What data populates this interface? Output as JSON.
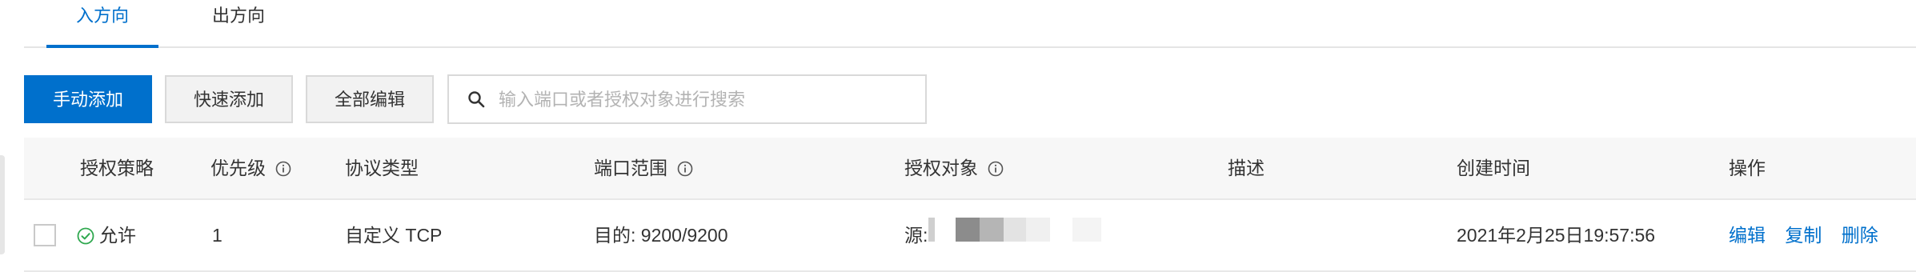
{
  "tabs": {
    "inbound": "入方向",
    "outbound": "出方向"
  },
  "toolbar": {
    "manual_add": "手动添加",
    "quick_add": "快速添加",
    "edit_all": "全部编辑",
    "search_placeholder": "输入端口或者授权对象进行搜索"
  },
  "table": {
    "headers": {
      "policy": "授权策略",
      "priority": "优先级",
      "protocol": "协议类型",
      "port_range": "端口范围",
      "auth_object": "授权对象",
      "description": "描述",
      "created": "创建时间",
      "actions": "操作"
    },
    "rows": [
      {
        "policy": "允许",
        "priority": "1",
        "protocol": "自定义 TCP",
        "port_range": "目的: 9200/9200",
        "auth_object_prefix": "源:",
        "description": "",
        "created": "2021年2月25日19:57:56",
        "actions": {
          "edit": "编辑",
          "copy": "复制",
          "delete": "删除"
        }
      }
    ]
  },
  "colors": {
    "accent": "#0070cc",
    "success": "#2fa84f"
  }
}
